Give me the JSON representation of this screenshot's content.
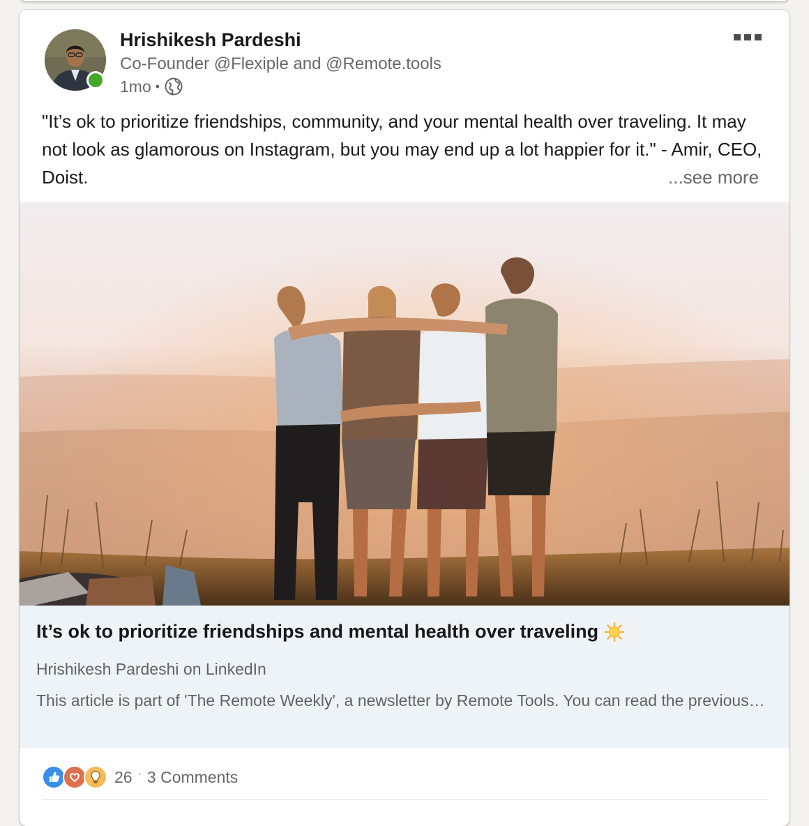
{
  "author": {
    "name": "Hrishikesh Pardeshi",
    "headline": "Co-Founder @Flexiple and @Remote.tools",
    "time": "1mo",
    "visibility_icon": "globe-icon",
    "presence_color": "#45a828"
  },
  "post": {
    "text": "\"It’s ok to prioritize friendships, community, and your mental health over traveling. It may not look as glamorous on Instagram, but you may end up a lot happier for it.\" - Amir, CEO, Doist.",
    "see_more": "...see more"
  },
  "article": {
    "image_icon": "sunset-friends-photo",
    "title": "It’s ok to prioritize friendships and mental health over traveling",
    "title_icon": "sun-icon",
    "source": "Hrishikesh Pardeshi on LinkedIn",
    "description": "This article is part of 'The Remote Weekly', a newsletter by Remote Tools. You can read the previous…"
  },
  "social": {
    "reaction_icons": [
      "like-icon",
      "love-icon",
      "insightful-icon"
    ],
    "reactions_count": "26",
    "separator": "·",
    "comments": "3 Comments"
  },
  "colors": {
    "accent": "#0a66c2",
    "article_bg": "#eef3f8",
    "like": "#378fe9",
    "love": "#df704d",
    "insightful": "#f5bb5c"
  }
}
